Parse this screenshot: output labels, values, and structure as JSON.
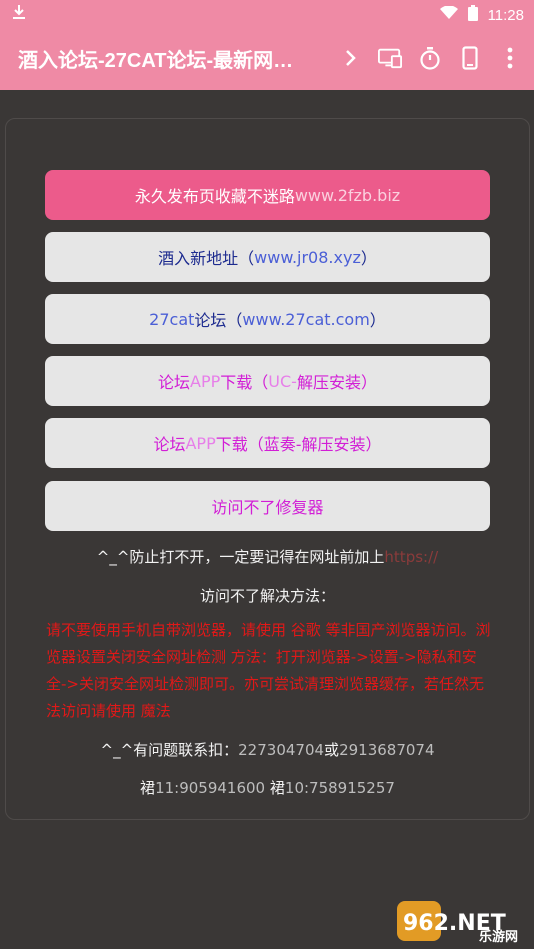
{
  "status": {
    "time": "11:28"
  },
  "appbar": {
    "title": "酒入论坛-27CAT论坛-最新网…",
    "chevron": ">"
  },
  "buttons": [
    {
      "prefix": "永久发布页收藏不迷路",
      "suffix": "www.2fzb.biz"
    },
    {
      "prefix": "酒入新地址（",
      "mid": "www.jr08.xyz",
      "suffix": "）"
    },
    {
      "prefix": "27cat",
      "mid": "论坛（",
      "mid2": "www.27cat.com",
      "suffix": "）"
    },
    {
      "prefix": "论坛",
      "mid": "APP",
      "mid2": "下载（",
      "mid3": "UC-",
      "suffix": "解压安装）"
    },
    {
      "prefix": "论坛",
      "mid": "APP",
      "mid2": "下载（蓝奏-解压安装）"
    },
    {
      "prefix": "访问不了修复器"
    }
  ],
  "notice": {
    "line1_prefix": "^_^防止打不开，一定要记得在网址前加上",
    "line1_suffix": "https://",
    "heading": "访问不了解决方法：",
    "paragraph": "请不要使用手机自带浏览器，请使用 谷歌 等非国产浏览器访问。浏览器设置关闭安全网址检测 方法：打开浏览器->设置->隐私和安全->关闭安全网址检测即可。亦可尝试清理浏览器缓存，若任然无法访问请使用 魔法",
    "contact_prefix": "^_^有问题联系扣：",
    "contact_a": "227304704",
    "contact_or": "或",
    "contact_b": "2913687074",
    "group1_label": "裙",
    "group1": "11:905941600",
    "group2_label": "裙",
    "group2": "10:758915257"
  },
  "watermark": {
    "line1": "962.NET",
    "line2": "乐游网"
  },
  "colors": {
    "bar": "#ef8aa5",
    "primary_button": "#ec5b8b",
    "magenta": "#d21ed6",
    "navy": "#1d2b8f",
    "link_blue": "#4b5fd6",
    "warning_red": "#e11818"
  }
}
